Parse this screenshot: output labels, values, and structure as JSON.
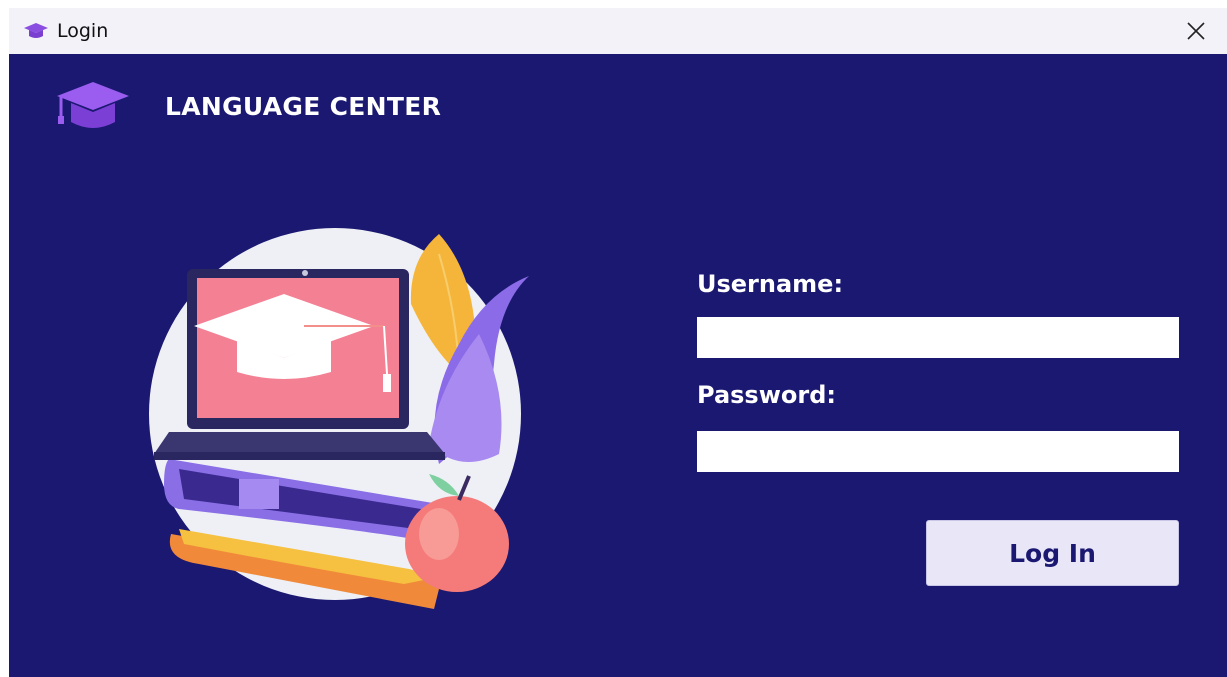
{
  "window": {
    "title": "Login",
    "app_icon": "graduation-cap-icon",
    "close_icon": "close-icon"
  },
  "brand": {
    "logo_icon": "graduation-cap-icon",
    "name": "LANGUAGE CENTER"
  },
  "illustration": {
    "description_icon": "laptop-books-apple-illustration"
  },
  "form": {
    "username_label": "Username:",
    "username_value": "",
    "password_label": "Password:",
    "password_value": "",
    "login_button": "Log In"
  },
  "colors": {
    "background": "#1a1870",
    "accent": "#8a4fe0",
    "button_bg": "#e8e6f7",
    "titlebar_bg": "#f3f2f9"
  }
}
